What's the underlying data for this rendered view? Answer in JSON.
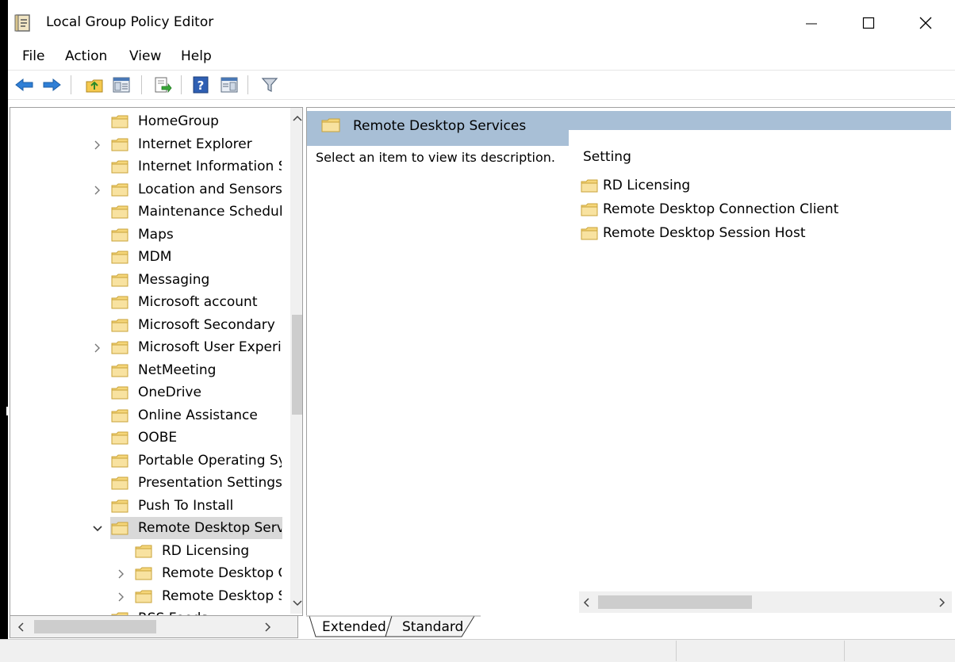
{
  "window": {
    "title": "Local Group Policy Editor"
  },
  "menu": [
    "File",
    "Action",
    "View",
    "Help"
  ],
  "tree": {
    "items": [
      {
        "label": "HomeGroup",
        "indent": 0,
        "expander": "none"
      },
      {
        "label": "Internet Explorer",
        "indent": 0,
        "expander": "collapsed"
      },
      {
        "label": "Internet Information Services",
        "indent": 0,
        "expander": "none"
      },
      {
        "label": "Location and Sensors",
        "indent": 0,
        "expander": "collapsed"
      },
      {
        "label": "Maintenance Scheduler",
        "indent": 0,
        "expander": "none"
      },
      {
        "label": "Maps",
        "indent": 0,
        "expander": "none"
      },
      {
        "label": "MDM",
        "indent": 0,
        "expander": "none"
      },
      {
        "label": "Messaging",
        "indent": 0,
        "expander": "none"
      },
      {
        "label": "Microsoft account",
        "indent": 0,
        "expander": "none"
      },
      {
        "label": "Microsoft Secondary",
        "indent": 0,
        "expander": "none"
      },
      {
        "label": "Microsoft User Experience",
        "indent": 0,
        "expander": "collapsed"
      },
      {
        "label": "NetMeeting",
        "indent": 0,
        "expander": "none"
      },
      {
        "label": "OneDrive",
        "indent": 0,
        "expander": "none"
      },
      {
        "label": "Online Assistance",
        "indent": 0,
        "expander": "none"
      },
      {
        "label": "OOBE",
        "indent": 0,
        "expander": "none"
      },
      {
        "label": "Portable Operating System",
        "indent": 0,
        "expander": "none"
      },
      {
        "label": "Presentation Settings",
        "indent": 0,
        "expander": "none"
      },
      {
        "label": "Push To Install",
        "indent": 0,
        "expander": "none"
      },
      {
        "label": "Remote Desktop Services",
        "indent": 0,
        "expander": "expanded",
        "selected": true
      },
      {
        "label": "RD Licensing",
        "indent": 1,
        "expander": "none"
      },
      {
        "label": "Remote Desktop Connection Client",
        "indent": 1,
        "expander": "collapsed"
      },
      {
        "label": "Remote Desktop Session Host",
        "indent": 1,
        "expander": "collapsed"
      },
      {
        "label": "RSS Feeds",
        "indent": 0,
        "expander": "none"
      }
    ]
  },
  "details": {
    "header": "Remote Desktop Services",
    "description": "Select an item to view its description.",
    "column_header": "Setting",
    "items": [
      "RD Licensing",
      "Remote Desktop Connection Client",
      "Remote Desktop Session Host"
    ]
  },
  "tabs": [
    "Extended",
    "Standard"
  ],
  "colors": {
    "header_band": "#a8bfd6",
    "folder_yellow": "#f5d67a",
    "selection": "#d9d9d9"
  }
}
